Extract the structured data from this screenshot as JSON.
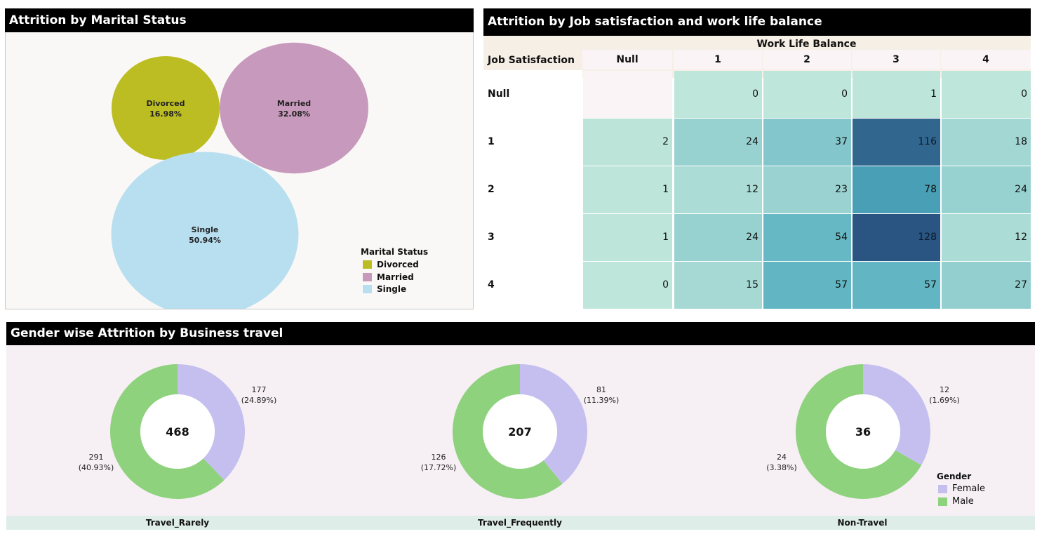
{
  "chart_data": [
    {
      "type": "bubble",
      "title": "Attrition by Marital Status",
      "categories": [
        "Divorced",
        "Married",
        "Single"
      ],
      "values": [
        16.98,
        32.08,
        50.94
      ],
      "value_labels": [
        "16.98%",
        "32.08%",
        "50.94%"
      ],
      "colors": [
        "#bcbd22",
        "#c799bc",
        "#b8dff0"
      ],
      "legend": {
        "title": "Marital Status",
        "placement": "bottom-right",
        "items": [
          "Divorced",
          "Married",
          "Single"
        ]
      }
    },
    {
      "type": "heatmap",
      "title": "Attrition by Job satisfaction and work life balance",
      "column_group_title": "Work Life Balance",
      "row_title": "Job Satisfaction",
      "columns": [
        "Null",
        "1",
        "2",
        "3",
        "4"
      ],
      "rows": [
        "Null",
        "1",
        "2",
        "3",
        "4"
      ],
      "values": [
        [
          null,
          0,
          0,
          1,
          0
        ],
        [
          2,
          24,
          37,
          116,
          18
        ],
        [
          1,
          12,
          23,
          78,
          24
        ],
        [
          1,
          24,
          54,
          128,
          12
        ],
        [
          0,
          15,
          57,
          57,
          27
        ]
      ],
      "color_range": [
        "#bfe6da",
        "#2a5481"
      ]
    },
    {
      "type": "pie",
      "title": "Gender wise Attrition by Business travel",
      "donuts": [
        {
          "category": "Travel_Rarely",
          "total": "468",
          "slices": [
            {
              "gender": "Female",
              "value": 177,
              "label": "177",
              "pct": "(24.89%)"
            },
            {
              "gender": "Male",
              "value": 291,
              "label": "291",
              "pct": "(40.93%)"
            }
          ]
        },
        {
          "category": "Travel_Frequently",
          "total": "207",
          "slices": [
            {
              "gender": "Female",
              "value": 81,
              "label": "81",
              "pct": "(11.39%)"
            },
            {
              "gender": "Male",
              "value": 126,
              "label": "126",
              "pct": "(17.72%)"
            }
          ]
        },
        {
          "category": "Non-Travel",
          "total": "36",
          "slices": [
            {
              "gender": "Female",
              "value": 12,
              "label": "12",
              "pct": "(1.69%)"
            },
            {
              "gender": "Male",
              "value": 24,
              "label": "24",
              "pct": "(3.38%)"
            }
          ]
        }
      ],
      "legend": {
        "title": "Gender",
        "placement": "bottom-right",
        "items": [
          {
            "name": "Female",
            "color": "#c5bfef"
          },
          {
            "name": "Male",
            "color": "#8ed27d"
          }
        ]
      }
    }
  ]
}
